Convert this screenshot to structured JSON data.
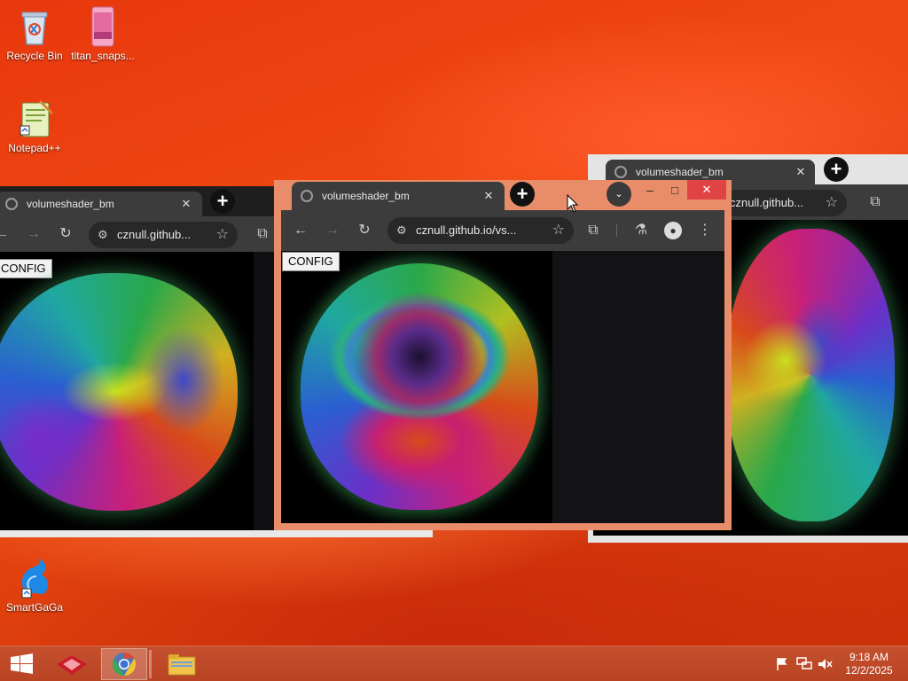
{
  "desktop": {
    "icons": [
      {
        "label": "Recycle Bin",
        "icon": "recycle-bin-icon"
      },
      {
        "label": "titan_snaps...",
        "icon": "image-file-icon"
      },
      {
        "label": "Notepad++",
        "icon": "notepad-plus-plus-icon"
      },
      {
        "label": "SmartGaGa",
        "icon": "smartgaga-icon"
      }
    ]
  },
  "windows": {
    "left": {
      "tab_title": "volumeshader_bm",
      "url": "cznull.github...",
      "config_label": "CONFIG"
    },
    "center": {
      "tab_title": "volumeshader_bm",
      "url": "cznull.github.io/vs...",
      "config_label": "CONFIG",
      "frame_color": "#e88c6a"
    },
    "right": {
      "tab_title": "volumeshader_bm",
      "url": "cznull.github..."
    }
  },
  "taskbar": {
    "time": "9:18 AM",
    "date": "12/2/2025",
    "apps": [
      "start-icon",
      "app-red-icon",
      "chrome-icon",
      "file-explorer-icon"
    ],
    "tray": [
      "flag-icon",
      "network-icon",
      "volume-muted-icon"
    ]
  }
}
